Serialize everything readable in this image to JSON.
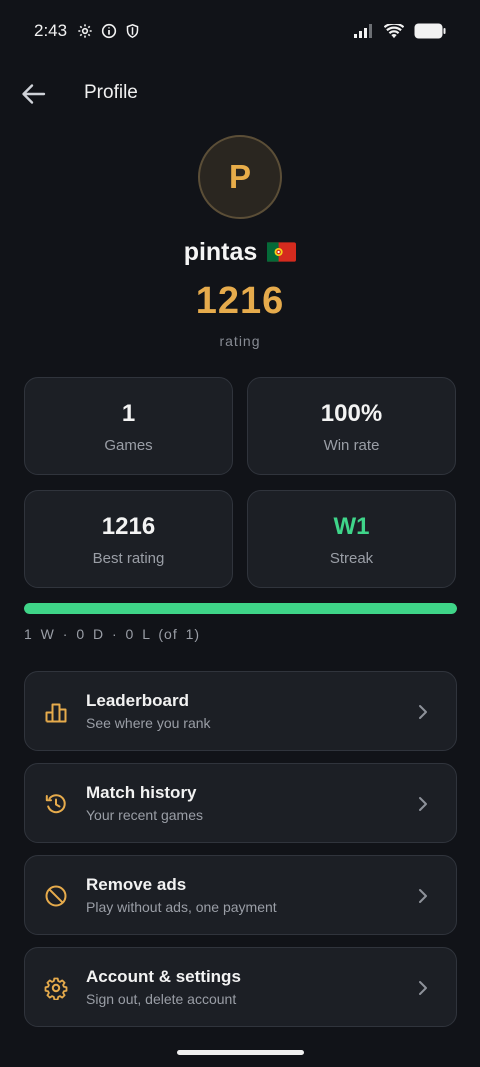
{
  "status_bar": {
    "time": "2:43"
  },
  "app_bar": {
    "title": "Profile"
  },
  "profile": {
    "initial": "P",
    "username": "pintas",
    "flag_country": "Portugal",
    "rating": "1216",
    "rating_label": "rating"
  },
  "stats": [
    {
      "value": "1",
      "label": "Games"
    },
    {
      "value": "100%",
      "label": "Win rate"
    },
    {
      "value": "1216",
      "label": "Best rating"
    },
    {
      "value": "W1",
      "label": "Streak"
    }
  ],
  "record": {
    "text": "1 W · 0 D · 0 L  (of 1)",
    "win_fraction": 1.0
  },
  "menu": [
    {
      "title": "Leaderboard",
      "subtitle": "See where you rank",
      "icon": "leaderboard-icon"
    },
    {
      "title": "Match history",
      "subtitle": "Your recent games",
      "icon": "history-icon"
    },
    {
      "title": "Remove ads",
      "subtitle": "Play without ads, one payment",
      "icon": "block-icon"
    },
    {
      "title": "Account & settings",
      "subtitle": "Sign out, delete account",
      "icon": "gear-icon"
    }
  ],
  "colors": {
    "background": "#111318",
    "accent_gold": "#e6ab4c",
    "accent_green": "#3fd588",
    "card": "#1c1f25"
  }
}
